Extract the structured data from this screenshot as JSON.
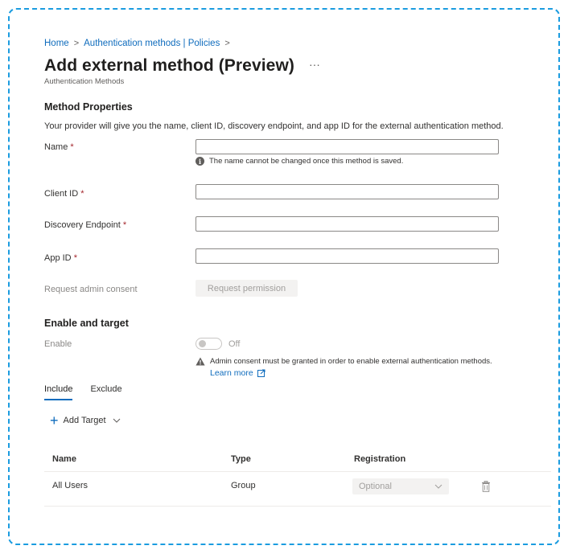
{
  "breadcrumb": {
    "items": [
      "Home",
      "Authentication methods | Policies"
    ],
    "separator": ">"
  },
  "header": {
    "title": "Add external method (Preview)",
    "ellipsis": "···",
    "subtitle": "Authentication Methods"
  },
  "method_properties": {
    "heading": "Method Properties",
    "description": "Your provider will give you the name, client ID, discovery endpoint, and app ID for the external authentication method.",
    "fields": {
      "name": {
        "label": "Name",
        "required_mark": "*",
        "value": ""
      },
      "client_id": {
        "label": "Client ID",
        "required_mark": "*",
        "value": ""
      },
      "discovery_endpoint": {
        "label": "Discovery Endpoint",
        "required_mark": "*",
        "value": ""
      },
      "app_id": {
        "label": "App ID",
        "required_mark": "*",
        "value": ""
      }
    },
    "name_info": "The name cannot be changed once this method is saved.",
    "admin_consent_label": "Request admin consent",
    "request_permission_button": "Request permission"
  },
  "enable_target": {
    "heading": "Enable and target",
    "enable_label": "Enable",
    "toggle_state": "Off",
    "warning": "Admin consent must be granted in order to enable external authentication methods.",
    "learn_more": "Learn more",
    "tabs": [
      "Include",
      "Exclude"
    ],
    "active_tab": "Include",
    "add_target": "Add Target"
  },
  "table": {
    "columns": [
      "Name",
      "Type",
      "Registration"
    ],
    "rows": [
      {
        "name": "All Users",
        "type": "Group",
        "registration": "Optional"
      }
    ]
  },
  "colors": {
    "accent": "#0f6cbd",
    "required": "#a4262c",
    "frame_border": "#1b9ce0"
  },
  "icons": [
    "info-icon",
    "warning-icon",
    "external-link-icon",
    "plus-icon",
    "chevron-down-icon",
    "trash-icon"
  ]
}
